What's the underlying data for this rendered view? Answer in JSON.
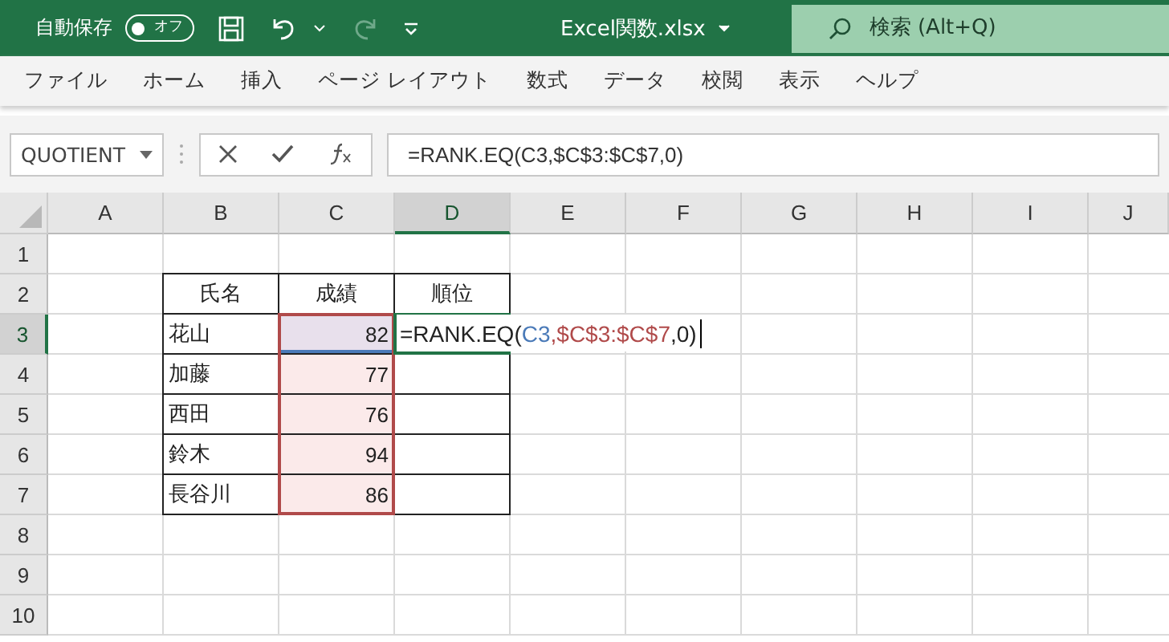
{
  "title_bar": {
    "autosave_label": "自動保存",
    "autosave_toggle": {
      "label": "オフ",
      "on": false
    },
    "file_title": "Excel関数.xlsx",
    "search": {
      "placeholder": "検索 (Alt+Q)"
    }
  },
  "ribbon_tabs": [
    "ファイル",
    "ホーム",
    "挿入",
    "ページ レイアウト",
    "数式",
    "データ",
    "校閲",
    "表示",
    "ヘルプ"
  ],
  "formula_bar": {
    "name_box": "QUOTIENT",
    "formula": "=RANK.EQ(C3,$C$3:$C$7,0)"
  },
  "sheet": {
    "columns": [
      {
        "label": "A",
        "selected": false
      },
      {
        "label": "B",
        "selected": false
      },
      {
        "label": "C",
        "selected": false
      },
      {
        "label": "D",
        "selected": true
      },
      {
        "label": "E",
        "selected": false
      },
      {
        "label": "F",
        "selected": false
      },
      {
        "label": "G",
        "selected": false
      },
      {
        "label": "H",
        "selected": false
      },
      {
        "label": "I",
        "selected": false
      },
      {
        "label": "J",
        "selected": false
      }
    ],
    "rows": [
      {
        "label": "1",
        "selected": false
      },
      {
        "label": "2",
        "selected": false
      },
      {
        "label": "3",
        "selected": true
      },
      {
        "label": "4",
        "selected": false
      },
      {
        "label": "5",
        "selected": false
      },
      {
        "label": "6",
        "selected": false
      },
      {
        "label": "7",
        "selected": false
      },
      {
        "label": "8",
        "selected": false
      },
      {
        "label": "9",
        "selected": false
      },
      {
        "label": "10",
        "selected": false
      }
    ],
    "table": {
      "header": [
        "氏名",
        "成績",
        "順位"
      ],
      "rows": [
        {
          "name": "花山",
          "score": "82"
        },
        {
          "name": "加藤",
          "score": "77"
        },
        {
          "name": "西田",
          "score": "76"
        },
        {
          "name": "鈴木",
          "score": "94"
        },
        {
          "name": "長谷川",
          "score": "86"
        }
      ]
    },
    "editing_cell": {
      "segments": [
        {
          "text": "=RANK.EQ(",
          "color": "#222222"
        },
        {
          "text": "C3",
          "color": "#4a7ab8"
        },
        {
          "text": ",$C$3:$C$7",
          "color": "#b04a4a"
        },
        {
          "text": ",0)",
          "color": "#222222"
        }
      ]
    }
  }
}
